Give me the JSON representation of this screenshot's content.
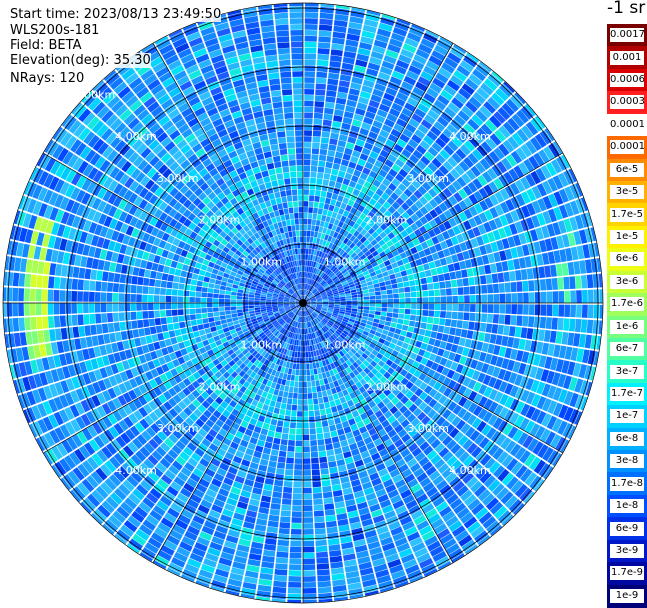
{
  "header": {
    "start_time": "Start time: 2023/08/13 23:49:50",
    "instrument": "WLS200s-181",
    "field": "Field: BETA",
    "elevation": "Elevation(deg): 35.30",
    "nrays": "NRays: 120"
  },
  "colorbar": {
    "unit": "-1 sr",
    "ticks": [
      "0.0017",
      "0.001",
      "0.0006",
      "0.0003",
      "0.00017",
      "0.0001",
      "6e-5",
      "3e-5",
      "1.7e-5",
      "1e-5",
      "6e-6",
      "3e-6",
      "1.7e-6",
      "1e-6",
      "6e-7",
      "3e-7",
      "1.7e-7",
      "1e-7",
      "6e-8",
      "3e-8",
      "1.7e-8",
      "1e-8",
      "6e-9",
      "3e-9",
      "1.7e-9",
      "1e-9"
    ],
    "colors": [
      "#7a0000",
      "#b00000",
      "#d80000",
      "#ff1f1f",
      "#ffffff",
      "#ff6a00",
      "#ff8c00",
      "#ffb000",
      "#ffd200",
      "#fff000",
      "#ecff14",
      "#c8ff37",
      "#a0ff5a",
      "#78ff7e",
      "#50ffa2",
      "#28ffc8",
      "#00f0ff",
      "#00d0ff",
      "#00b0ff",
      "#0090ff",
      "#0070ff",
      "#0050ff",
      "#0030e8",
      "#0018c8",
      "#0008a0",
      "#000078"
    ]
  },
  "chart_data": {
    "type": "heatmap",
    "projection": "polar (PPI scan)",
    "field": "BETA",
    "elevation_deg": 35.3,
    "n_rays": 120,
    "scale": "log",
    "range_rings": [
      {
        "range_km": 1.0,
        "labels": [
          "1.00km",
          "1.00km",
          "1.00km",
          "1.00km"
        ]
      },
      {
        "range_km": 2.0,
        "labels": [
          "2.00km",
          "2.00km",
          "2.00km",
          "2.00km"
        ]
      },
      {
        "range_km": 3.0,
        "labels": [
          "3.00km",
          "3.00km",
          "3.00km",
          "3.00km"
        ]
      },
      {
        "range_km": 4.0,
        "labels": [
          "4.00km",
          "4.00km",
          "4.00km",
          "4.00km"
        ]
      },
      {
        "range_km": 5.0,
        "labels": [
          "5.00km"
        ]
      }
    ],
    "dominant_level": "1e-8 to 6e-8",
    "notable_feature": "yellow-green band (~1e-6 to 3e-6) to the west at about 4.5 km"
  }
}
